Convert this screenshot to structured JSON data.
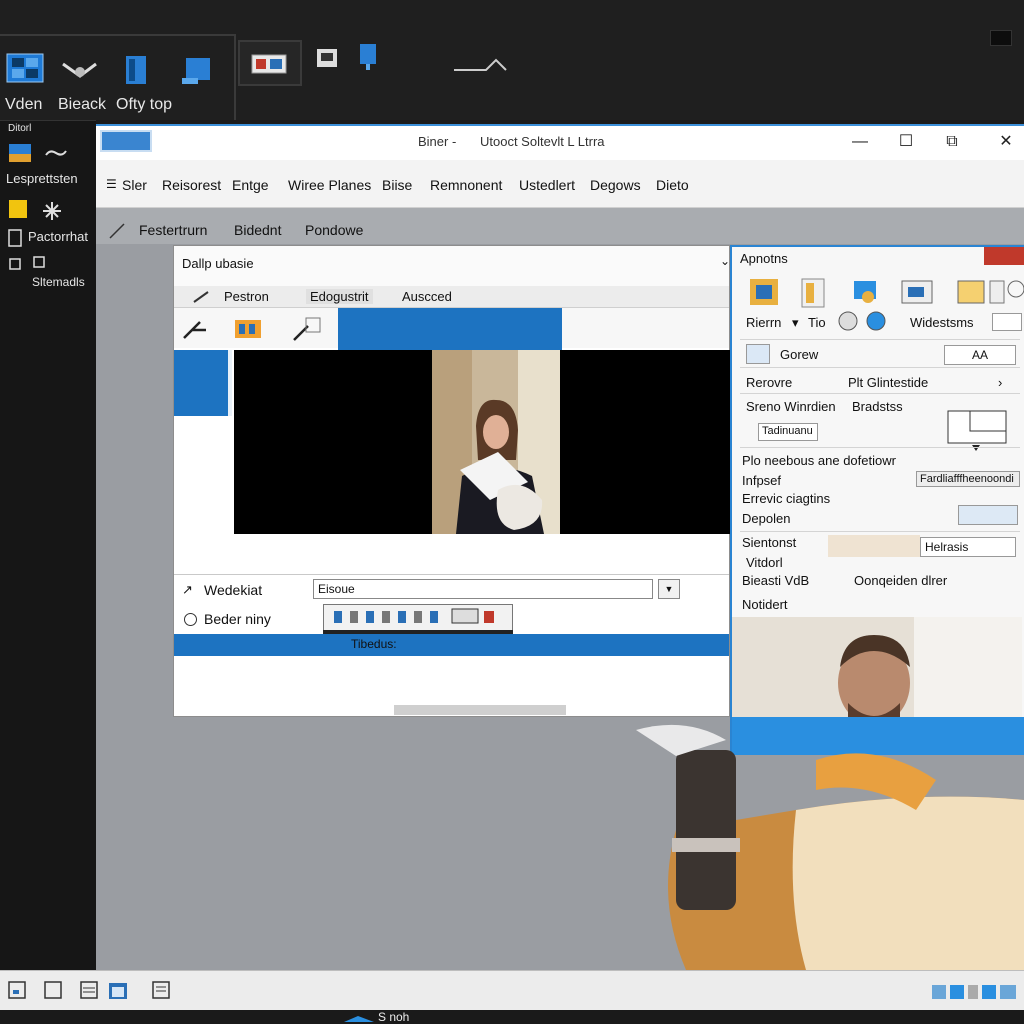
{
  "toolbar": {
    "items": [
      {
        "label": "Vden",
        "icon": "video-icon"
      },
      {
        "label": "Bieack",
        "icon": "tools-icon"
      },
      {
        "label": "Ofty top",
        "icon": "document-icon"
      }
    ]
  },
  "sidebar": {
    "header": "Ditorl",
    "items": [
      {
        "label": "Lesprettsten",
        "icon": "image-icon"
      },
      {
        "label": "Pactorrhat",
        "icon": "note-icon"
      },
      {
        "label": "Sltemadls",
        "icon": "layers-icon"
      }
    ]
  },
  "window": {
    "title": "Biner  -",
    "subtitle": "Utooct Soltevlt  L Ltrra",
    "controls": {
      "minimize": "—",
      "maximize": "☐",
      "close": "✕"
    },
    "menu": [
      "Sler",
      "Reisorest",
      "Entge",
      "Wiree Planes",
      "Biise",
      "Remnonent",
      "Ustedlert",
      "Degows",
      "Dieto"
    ],
    "subtoolbar": [
      "Festertrurn",
      "Bidednt",
      "Pondowe"
    ]
  },
  "dialog": {
    "header": "Dallp ubasie",
    "tabs": [
      "Pestron",
      "Edogustrit",
      "Auscced"
    ],
    "field1_label": "Wedekiat",
    "field1_value": "Eisoue",
    "field2_label": "Beder niny",
    "bar_label": "Tibedus:"
  },
  "panel": {
    "title": "Apnotns",
    "row1": {
      "a": "Rierrn",
      "b": "Tio",
      "c": "Widestsms"
    },
    "search_label": "Gorew",
    "search_btn": "AA",
    "row_remove": {
      "label": "Rerovre",
      "value": "Plt Glintestide"
    },
    "row_snap": {
      "label": "Sreno Winrdien",
      "value": "Bradstss"
    },
    "tag": "Tadinuanu",
    "section_title": "Plo neebous ane dofetiowr",
    "sec_lines": [
      "Infpsef",
      "Errevic ciagtins",
      "Depolen"
    ],
    "field_right": "Fardliafffheenoondi",
    "settings_label": "Sientonst",
    "settings_value": "Helrasis",
    "video_label": "Vitdorl",
    "video_res_label": "Bieasti VdB",
    "video_res_value": "Oonqeiden dlrer",
    "notify_label": "Notidert"
  },
  "bottom": {
    "status": "S noh"
  },
  "colors": {
    "accent": "#1d73c1",
    "titlebar_border": "#3b8fd8",
    "dark_bg": "#1b1b1b"
  }
}
